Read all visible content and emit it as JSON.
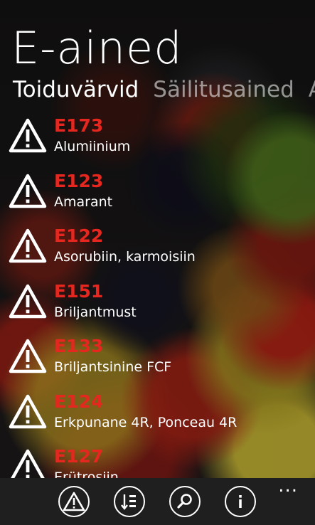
{
  "app": {
    "title": "E-ained"
  },
  "pivot": {
    "tabs": [
      {
        "label": "Toiduvärvid",
        "active": true
      },
      {
        "label": "Säilitusained",
        "active": false
      },
      {
        "label": "A",
        "active": false
      }
    ]
  },
  "list": {
    "items": [
      {
        "code": "E173",
        "name": "Alumiinium",
        "icon": "warning-triangle-icon"
      },
      {
        "code": "E123",
        "name": "Amarant",
        "icon": "warning-triangle-icon"
      },
      {
        "code": "E122",
        "name": "Asorubiin, karmoisiin",
        "icon": "warning-triangle-icon"
      },
      {
        "code": "E151",
        "name": "Briljantmust",
        "icon": "warning-triangle-icon"
      },
      {
        "code": "E133",
        "name": "Briljantsinine FCF",
        "icon": "warning-triangle-icon"
      },
      {
        "code": "E124",
        "name": "Erkpunane 4R, Ponceau 4R",
        "icon": "warning-triangle-icon"
      },
      {
        "code": "E127",
        "name": "Erütrosiin",
        "icon": "warning-triangle-icon"
      }
    ]
  },
  "appbar": {
    "buttons": [
      {
        "icon": "warning-filter-icon"
      },
      {
        "icon": "sort-icon"
      },
      {
        "icon": "search-icon"
      },
      {
        "icon": "info-icon"
      }
    ],
    "more_label": "..."
  },
  "colors": {
    "code_red": "#e5271f",
    "appbar_bg": "#1f1f1f",
    "text": "#ffffff"
  }
}
